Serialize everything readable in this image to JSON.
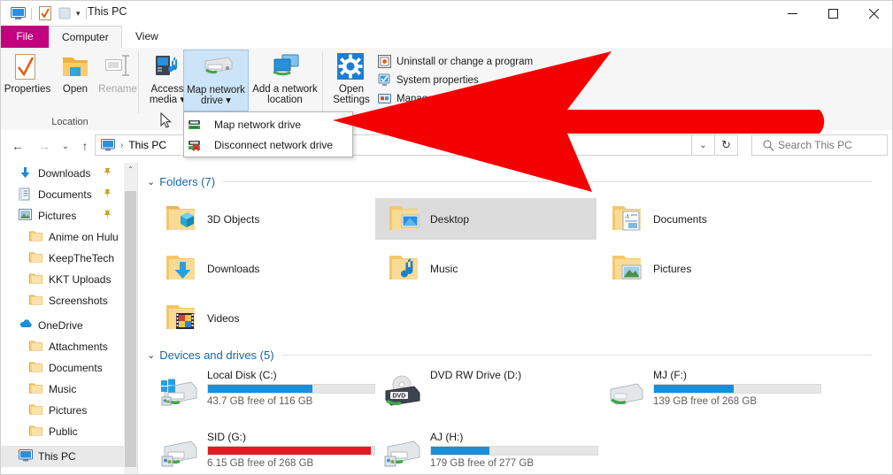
{
  "window": {
    "title": "This PC",
    "quick_access": [
      "this-pc-icon",
      "properties-icon",
      "new-folder-icon"
    ],
    "qat_caret": "▾",
    "minimize": "—",
    "maximize": "☐",
    "close": "✕"
  },
  "ribbon": {
    "tabs": [
      {
        "label": "File",
        "active": false,
        "file": true
      },
      {
        "label": "Computer",
        "active": true,
        "file": false
      },
      {
        "label": "View",
        "active": false,
        "file": false
      }
    ],
    "collapse_caret": "⌃",
    "help_label": "?",
    "groups": [
      {
        "label": "Location",
        "buttons": [
          {
            "label_line1": "Properties",
            "label_line2": "",
            "icon": "properties-icon",
            "disabled": false,
            "selected": false
          },
          {
            "label_line1": "Open",
            "label_line2": "",
            "icon": "open-folder-icon",
            "disabled": false,
            "selected": false
          },
          {
            "label_line1": "Rename",
            "label_line2": "",
            "icon": "rename-icon",
            "disabled": true,
            "selected": false
          }
        ]
      },
      {
        "label": "",
        "buttons": [
          {
            "label_line1": "Access",
            "label_line2": "media ▾",
            "icon": "access-media-icon",
            "disabled": false,
            "selected": false
          },
          {
            "label_line1": "Map network",
            "label_line2": "drive ▾",
            "icon": "map-network-drive-icon",
            "disabled": false,
            "selected": true
          },
          {
            "label_line1": "Add a network",
            "label_line2": "location",
            "icon": "add-network-location-icon",
            "disabled": false,
            "selected": false
          }
        ]
      },
      {
        "label": "",
        "buttons": [
          {
            "label_line1": "Open",
            "label_line2": "Settings",
            "icon": "settings-gear-icon",
            "disabled": false,
            "selected": false
          }
        ],
        "small_items": [
          {
            "label": "Uninstall or change a program",
            "icon": "uninstall-program-icon"
          },
          {
            "label": "System properties",
            "icon": "system-properties-icon"
          },
          {
            "label": "Manage",
            "icon": "manage-icon"
          }
        ]
      }
    ]
  },
  "dropdown": {
    "open": true,
    "items": [
      {
        "label": "Map network drive",
        "icon": "map-network-drive-small-icon"
      },
      {
        "label": "Disconnect network drive",
        "icon": "disconnect-network-drive-icon"
      }
    ]
  },
  "addressbar": {
    "back": "←",
    "forward": "→",
    "recent_caret": "⌄",
    "up": "↑",
    "crumb_icon": "this-pc-icon",
    "crumb_text": "This PC",
    "crumb_sep": "›",
    "dropdown_caret": "⌄",
    "refresh": "↻",
    "search_placeholder": "Search This PC",
    "search_value": ""
  },
  "navpane": {
    "items": [
      {
        "label": "Downloads",
        "icon": "downloads-arrow-icon",
        "pinned": true,
        "indent": 20,
        "selected": false
      },
      {
        "label": "Documents",
        "icon": "documents-icon",
        "pinned": true,
        "indent": 20,
        "selected": false
      },
      {
        "label": "Pictures",
        "icon": "pictures-icon",
        "pinned": true,
        "indent": 20,
        "selected": false
      },
      {
        "label": "Anime on Hulu",
        "icon": "folder-icon",
        "pinned": false,
        "indent": 30,
        "selected": false
      },
      {
        "label": "KeepTheTech",
        "icon": "folder-icon",
        "pinned": false,
        "indent": 30,
        "selected": false
      },
      {
        "label": "KKT Uploads",
        "icon": "folder-icon",
        "pinned": false,
        "indent": 30,
        "selected": false
      },
      {
        "label": "Screenshots",
        "icon": "folder-icon",
        "pinned": false,
        "indent": 30,
        "selected": false
      },
      {
        "label": "OneDrive",
        "icon": "onedrive-cloud-icon",
        "pinned": false,
        "indent": 20,
        "selected": false
      },
      {
        "label": "Attachments",
        "icon": "folder-icon",
        "pinned": false,
        "indent": 30,
        "selected": false
      },
      {
        "label": "Documents",
        "icon": "folder-icon",
        "pinned": false,
        "indent": 30,
        "selected": false
      },
      {
        "label": "Music",
        "icon": "folder-icon",
        "pinned": false,
        "indent": 30,
        "selected": false
      },
      {
        "label": "Pictures",
        "icon": "folder-icon",
        "pinned": false,
        "indent": 30,
        "selected": false
      },
      {
        "label": "Public",
        "icon": "folder-icon",
        "pinned": false,
        "indent": 30,
        "selected": false
      },
      {
        "label": "This PC",
        "icon": "this-pc-icon",
        "pinned": false,
        "indent": 20,
        "selected": true
      }
    ],
    "scroll_up": "⌃",
    "scroll_down": "⌄"
  },
  "content": {
    "folders_group": {
      "chevron": "⌄",
      "title": "Folders (7)",
      "items": [
        {
          "label": "3D Objects",
          "icon": "folder-3d-objects-icon",
          "selected": false
        },
        {
          "label": "Desktop",
          "icon": "folder-desktop-icon",
          "selected": true
        },
        {
          "label": "Documents",
          "icon": "folder-documents-icon",
          "selected": false
        },
        {
          "label": "Downloads",
          "icon": "folder-downloads-icon",
          "selected": false
        },
        {
          "label": "Music",
          "icon": "folder-music-icon",
          "selected": false
        },
        {
          "label": "Pictures",
          "icon": "folder-pictures-icon",
          "selected": false
        },
        {
          "label": "Videos",
          "icon": "folder-videos-icon",
          "selected": false
        }
      ]
    },
    "drives_group": {
      "chevron": "⌄",
      "title": "Devices and drives (5)",
      "items": [
        {
          "label": "Local Disk (C:)",
          "icon": "windows-hard-drive-icon",
          "free_text": "43.7 GB free of 116 GB",
          "used_pct": 63,
          "bar_color": "#1a8fd8",
          "has_bar": true
        },
        {
          "label": "DVD RW Drive (D:)",
          "icon": "dvd-drive-icon",
          "free_text": "",
          "used_pct": 0,
          "bar_color": "",
          "has_bar": false
        },
        {
          "label": "MJ (F:)",
          "icon": "usb-drive-icon",
          "free_text": "139 GB free of 268 GB",
          "used_pct": 48,
          "bar_color": "#1a8fd8",
          "has_bar": true
        },
        {
          "label": "SID (G:)",
          "icon": "network-hard-drive-icon",
          "free_text": "6.15 GB free of 268 GB",
          "used_pct": 98,
          "bar_color": "#e01b24",
          "has_bar": true
        },
        {
          "label": "AJ (H:)",
          "icon": "network-hard-drive-icon",
          "free_text": "179 GB free of 277 GB",
          "used_pct": 35,
          "bar_color": "#1a8fd8",
          "has_bar": true
        }
      ]
    }
  },
  "annotation": {
    "type": "arrow",
    "color": "#f40000",
    "direction": "left",
    "points_to": "Map network drive"
  }
}
